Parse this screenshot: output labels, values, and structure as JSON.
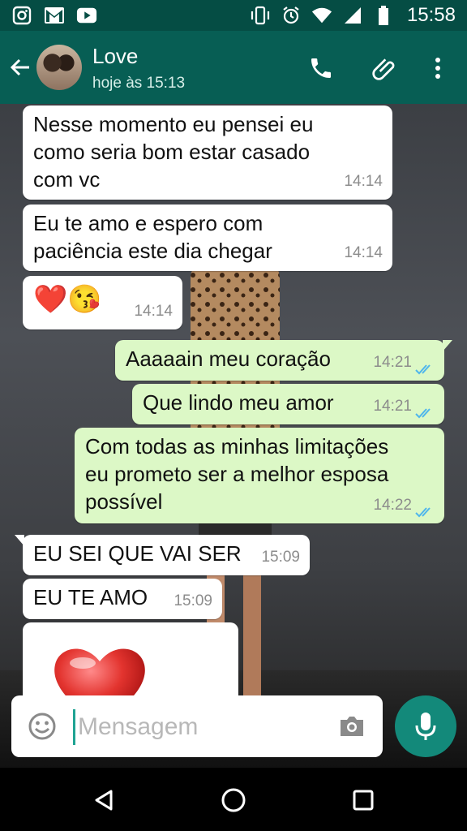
{
  "status_bar": {
    "time": "15:58",
    "left_icons": [
      "instagram-icon",
      "gmail-icon",
      "youtube-icon"
    ],
    "right_icons": [
      "vibrate-icon",
      "alarm-icon",
      "wifi-icon",
      "signal-icon",
      "battery-icon"
    ]
  },
  "header": {
    "contact_name": "Love",
    "last_seen": "hoje às 15:13",
    "actions": [
      "call-icon",
      "attach-icon",
      "menu-icon"
    ]
  },
  "messages": [
    {
      "direction": "in",
      "text": "Nesse momento eu pensei eu\ncomo seria bom estar casado\ncom vc",
      "time": "14:14"
    },
    {
      "direction": "in",
      "text": "Eu te amo e espero com\npaciência este dia chegar",
      "time": "14:14"
    },
    {
      "direction": "in",
      "text": "❤️😘",
      "time": "14:14"
    },
    {
      "direction": "out",
      "text": "Aaaaain meu coração",
      "time": "14:21",
      "status": "read"
    },
    {
      "direction": "out",
      "text": "Que lindo meu amor",
      "time": "14:21",
      "status": "read"
    },
    {
      "direction": "out",
      "text": "Com todas as minhas limitações\neu prometo ser a melhor esposa\npossível",
      "time": "14:22",
      "status": "read"
    },
    {
      "direction": "in",
      "text": "EU SEI QUE VAI SER",
      "time": "15:09"
    },
    {
      "direction": "in",
      "text": "EU TE AMO",
      "time": "15:09"
    },
    {
      "direction": "in",
      "text": "❤️",
      "time": ""
    }
  ],
  "composer": {
    "placeholder": "Mensagem"
  },
  "colors": {
    "status_bar": "#054d44",
    "app_bar": "#075e54",
    "outgoing_bubble": "#dcf8c6",
    "incoming_bubble": "#ffffff",
    "mic_button": "#13897a",
    "read_ticks": "#4fb6ec"
  }
}
